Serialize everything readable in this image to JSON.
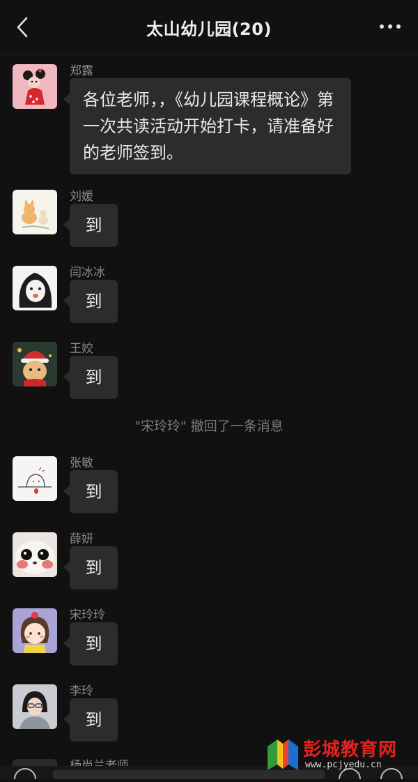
{
  "header": {
    "title": "太山幼儿园(20)"
  },
  "messages": [
    {
      "sender": "郑露",
      "text": "各位老师，，《幼儿园课程概论》第一次共读活动开始打卡，请准备好的老师签到。"
    },
    {
      "sender": "刘媛",
      "text": "到"
    },
    {
      "sender": "闫冰冰",
      "text": "到"
    },
    {
      "sender": "王姣",
      "text": "到"
    },
    {
      "sender": "张敏",
      "text": "到"
    },
    {
      "sender": "薛妍",
      "text": "到"
    },
    {
      "sender": "宋玲玲",
      "text": "到"
    },
    {
      "sender": "李玲",
      "text": "到"
    }
  ],
  "system_notice": "\"宋玲玲\" 撤回了一条消息",
  "partial_sender": "杨尚兰老师",
  "watermark": {
    "title": "彭城教育网",
    "url": "www.pcjyedu.cn"
  },
  "colors": {
    "background": "#111111",
    "bubble": "#2c2c2c",
    "watermark_red": "#e8201e"
  }
}
